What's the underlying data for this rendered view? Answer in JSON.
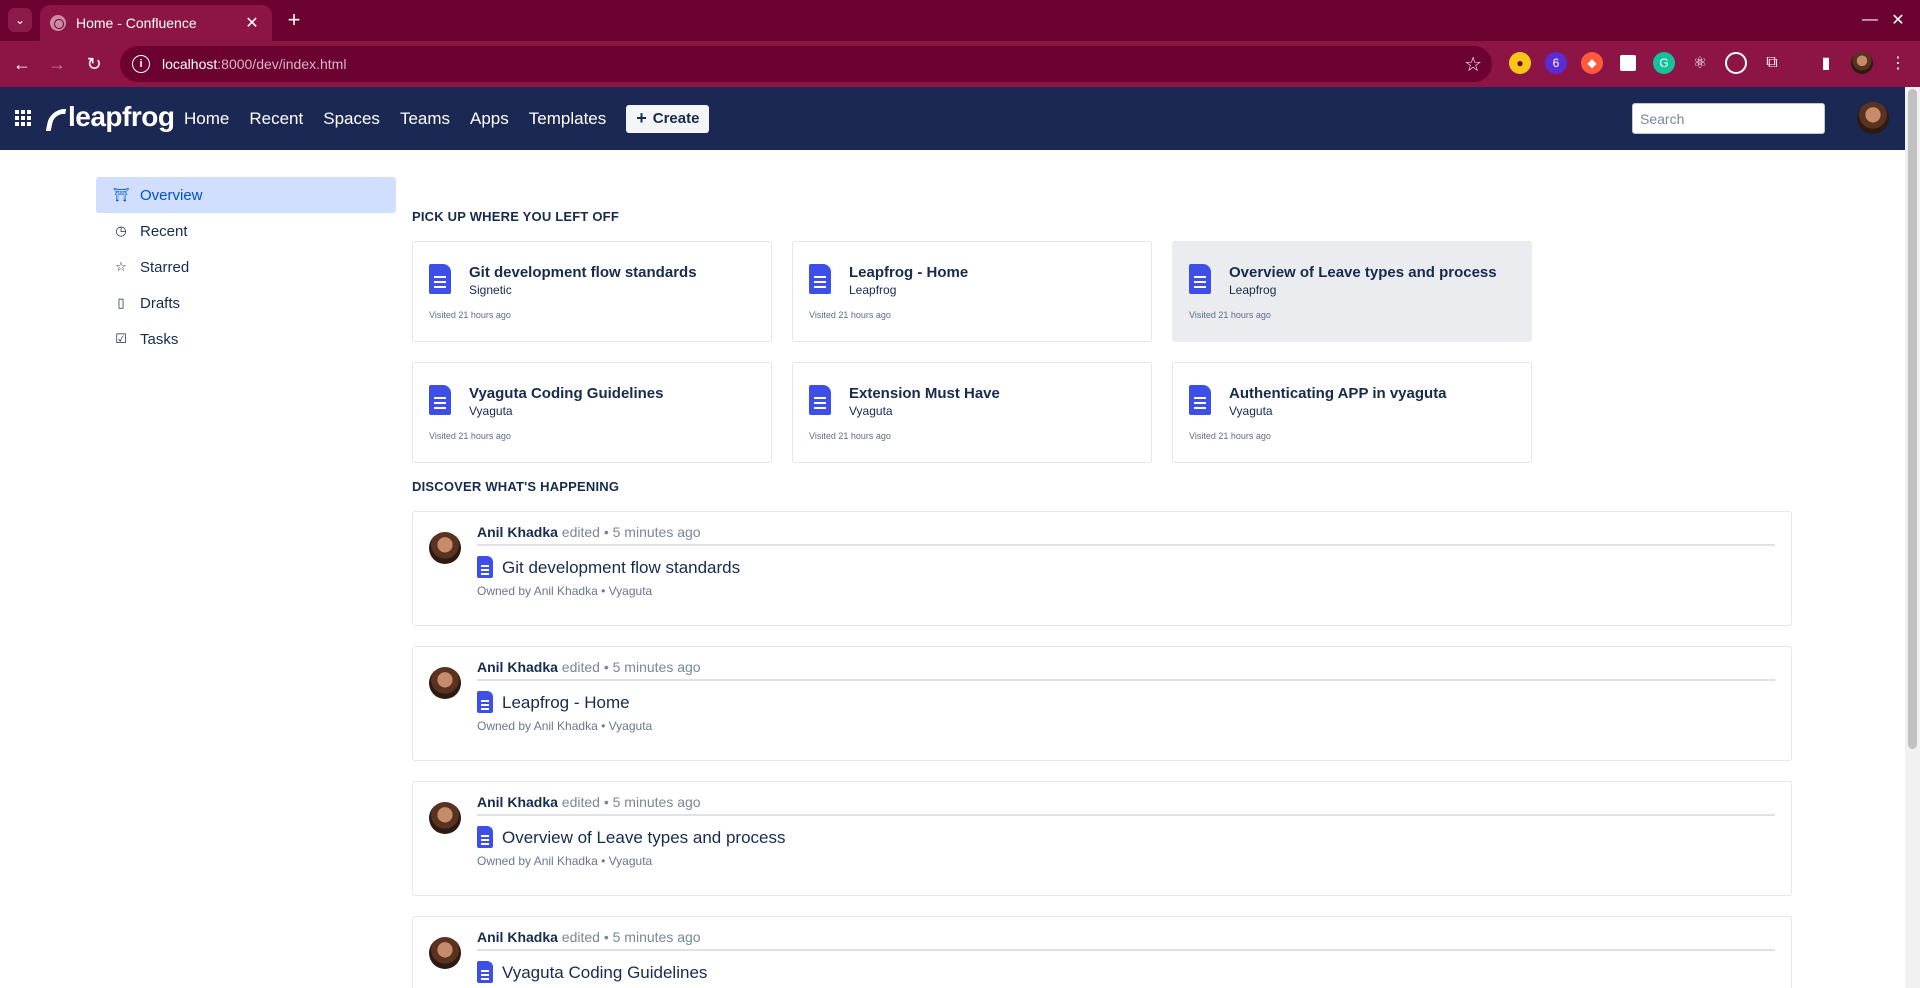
{
  "browser": {
    "tab_title": "Home - Confluence",
    "url_host": "localhost",
    "url_rest": ":8000/dev/index.html",
    "extension_badge": "6"
  },
  "header": {
    "logo_text": "leapfrog",
    "nav": [
      "Home",
      "Recent",
      "Spaces",
      "Teams",
      "Apps",
      "Templates"
    ],
    "create_label": "Create",
    "search_placeholder": "Search"
  },
  "sidebar": {
    "items": [
      {
        "label": "Overview",
        "icon": "overview-icon",
        "active": true
      },
      {
        "label": "Recent",
        "icon": "clock-icon",
        "active": false
      },
      {
        "label": "Starred",
        "icon": "star-icon",
        "active": false
      },
      {
        "label": "Drafts",
        "icon": "file-icon",
        "active": false
      },
      {
        "label": "Tasks",
        "icon": "checkbox-icon",
        "active": false
      }
    ]
  },
  "pickup": {
    "title": "PICK UP WHERE YOU LEFT OFF",
    "cards": [
      {
        "title": "Git development flow standards",
        "space": "Signetic",
        "visited": "Visited 21 hours ago"
      },
      {
        "title": "Leapfrog - Home",
        "space": "Leapfrog",
        "visited": "Visited 21 hours ago"
      },
      {
        "title": "Overview of Leave types and process",
        "space": "Leapfrog",
        "visited": "Visited 21 hours ago"
      },
      {
        "title": "Vyaguta Coding Guidelines",
        "space": "Vyaguta",
        "visited": "Visited 21 hours ago"
      },
      {
        "title": "Extension Must Have",
        "space": "Vyaguta",
        "visited": "Visited 21 hours ago"
      },
      {
        "title": "Authenticating APP in vyaguta",
        "space": "Vyaguta",
        "visited": "Visited 21 hours ago"
      }
    ]
  },
  "discover": {
    "title": "DISCOVER WHAT'S HAPPENING",
    "items": [
      {
        "user": "Anil Khadka",
        "action": "edited • 5 minutes ago",
        "doc": "Git development flow standards",
        "owner": "Owned by Anil Khadka • Vyaguta"
      },
      {
        "user": "Anil Khadka",
        "action": "edited • 5 minutes ago",
        "doc": "Leapfrog - Home",
        "owner": "Owned by Anil Khadka • Vyaguta"
      },
      {
        "user": "Anil Khadka",
        "action": "edited • 5 minutes ago",
        "doc": "Overview of Leave types and process",
        "owner": "Owned by Anil Khadka • Vyaguta"
      },
      {
        "user": "Anil Khadka",
        "action": "edited • 5 minutes ago",
        "doc": "Vyaguta Coding Guidelines",
        "owner": ""
      }
    ]
  },
  "colors": {
    "tab_bar": "#6b0230",
    "toolbar": "#8c1546",
    "app_header": "#1b2853",
    "doc_icon": "#3d4fe8",
    "sidebar_active": "#d1defe"
  }
}
